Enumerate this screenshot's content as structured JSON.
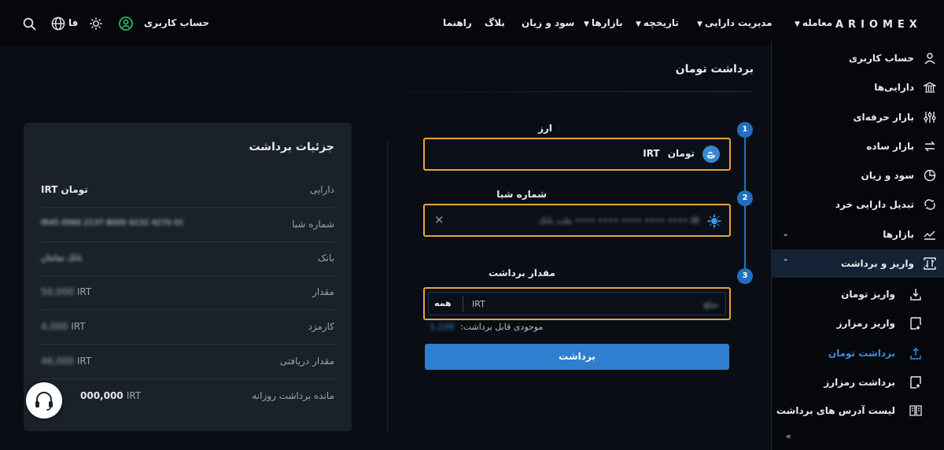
{
  "header": {
    "logo": "ARIOMEX",
    "nav": [
      {
        "label": "معامله",
        "dropdown": true
      },
      {
        "label": "مدیریت دارایی",
        "dropdown": true
      },
      {
        "label": "تاریخچه",
        "dropdown": true
      },
      {
        "label": "بازارها",
        "dropdown": true
      },
      {
        "label": "سود و زیان",
        "dropdown": false
      },
      {
        "label": "بلاگ",
        "dropdown": false
      },
      {
        "label": "راهنما",
        "dropdown": false
      }
    ],
    "user_account": "حساب کاربری",
    "language": "فا",
    "icons": [
      "user-circle-icon",
      "theme-sun-icon",
      "globe-icon",
      "search-icon"
    ]
  },
  "sidebar": {
    "items": [
      {
        "label": "حساب کاربری",
        "icon": "user-icon"
      },
      {
        "label": "دارایی‌ها",
        "icon": "bank-icon"
      },
      {
        "label": "بازار حرفه‌ای",
        "icon": "sliders-icon"
      },
      {
        "label": "بازار ساده",
        "icon": "swap-icon"
      },
      {
        "label": "سود و زیان",
        "icon": "pie-chart-icon"
      },
      {
        "label": "تبدیل دارایی خرد",
        "icon": "convert-icon"
      },
      {
        "label": "بازارها",
        "icon": "chart-line-icon"
      },
      {
        "label": "واریز و برداشت",
        "icon": "transfer-icon"
      }
    ],
    "sub_items": [
      {
        "label": "واریز تومان",
        "icon": "download-icon"
      },
      {
        "label": "واریز رمزارز",
        "icon": "deposit-crypto-icon"
      },
      {
        "label": "برداشت تومان",
        "icon": "upload-icon"
      },
      {
        "label": "برداشت رمزارز",
        "icon": "withdraw-crypto-icon"
      },
      {
        "label": "لیست آدرس های برداشت",
        "icon": "address-book-icon"
      }
    ]
  },
  "form": {
    "title": "برداشت تومان",
    "steps": [
      "1",
      "2",
      "3"
    ],
    "currency_label": "ارز",
    "currency_code": "IRT",
    "currency_name": "تومان",
    "sheba_label": "شماره شبا",
    "sheba_value": "IR •••• •••• •••• •••• •••• ملت بانک",
    "clear_icon": "×",
    "amount_label": "مقدار برداشت",
    "amount_placeholder": "مبلغ",
    "amount_unit": "IRT",
    "all_button": "همه",
    "available_label": "موجودی قابل برداشت:",
    "available_value": "1,100",
    "submit_label": "برداشت"
  },
  "details": {
    "title": "جزئیات برداشت",
    "rows": [
      {
        "label": "دارایی",
        "value": "IRT تومان"
      },
      {
        "label": "شماره شبا",
        "value": "IR45 0560 2137 8000 4232 4270 01"
      },
      {
        "label": "بانک",
        "value": "بانک سامان"
      },
      {
        "label": "مقدار",
        "value": "50,000",
        "unit": "IRT"
      },
      {
        "label": "کارمزد",
        "value": "4,000",
        "unit": "IRT"
      },
      {
        "label": "مقدار دریافتی",
        "value": "46,000",
        "unit": "IRT"
      },
      {
        "label": "مانده برداشت روزانه",
        "value": "000,000",
        "unit": "IRT"
      }
    ]
  },
  "colors": {
    "accent": "#2f7fd0",
    "highlight_border": "#e8a33a",
    "card_bg": "#1a212b"
  }
}
